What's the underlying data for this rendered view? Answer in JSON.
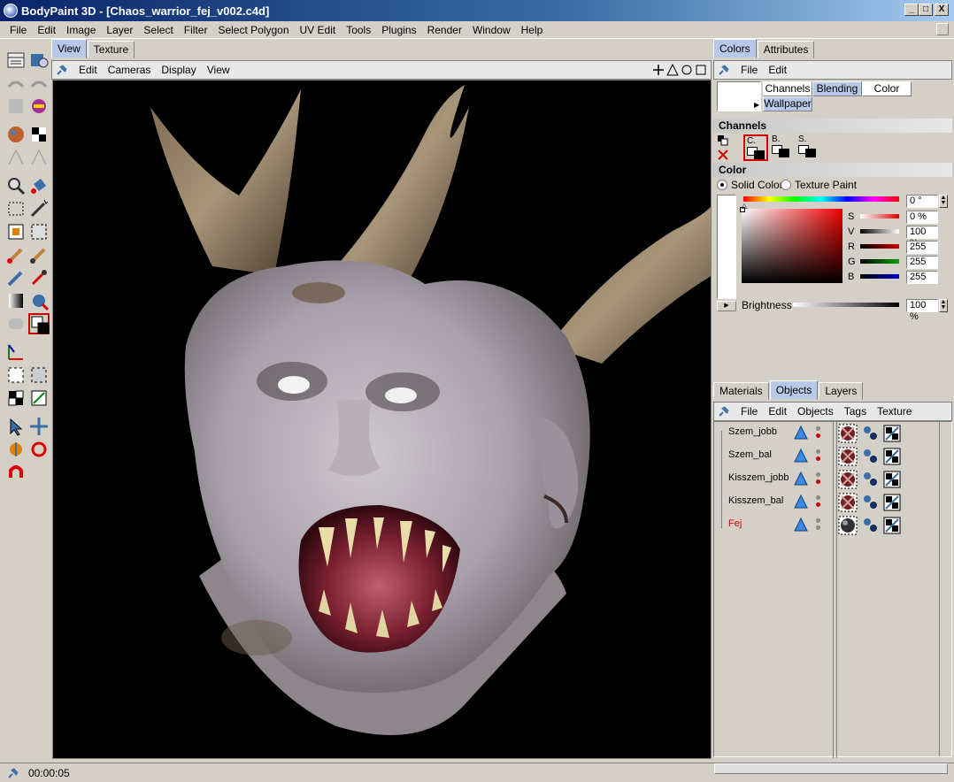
{
  "window": {
    "title": "BodyPaint 3D - [Chaos_warrior_fej_v002.c4d]",
    "min_label": "_",
    "max_label": "□",
    "close_label": "X"
  },
  "menubar": [
    "File",
    "Edit",
    "Image",
    "Layer",
    "Select",
    "Filter",
    "Select Polygon",
    "UV Edit",
    "Tools",
    "Plugins",
    "Render",
    "Window",
    "Help"
  ],
  "view_tabs": [
    "View",
    "Texture"
  ],
  "view_menu": [
    "Edit",
    "Cameras",
    "Display",
    "View"
  ],
  "status": {
    "time": "00:00:05"
  },
  "colors_panel": {
    "tabs": [
      "Colors",
      "Attributes"
    ],
    "menu": [
      "File",
      "Edit"
    ],
    "mode_tabs": [
      "Channels",
      "Blending",
      "Color",
      "Wallpaper"
    ],
    "channels_header": "Channels",
    "channel_labels": [
      "C.",
      "B.",
      "S."
    ],
    "color_header": "Color",
    "radio_solid": "Solid Color",
    "radio_texture": "Texture Paint",
    "hue_value": "0 °",
    "sliders": [
      {
        "label": "S",
        "value": "0 %",
        "color": "#e00000"
      },
      {
        "label": "V",
        "value": "100 %",
        "color": "#000000"
      },
      {
        "label": "R",
        "value": "255",
        "color": "#cc0000"
      },
      {
        "label": "G",
        "value": "255",
        "color": "#00a000"
      },
      {
        "label": "B",
        "value": "255",
        "color": "#0000cc"
      }
    ],
    "brightness_label": "Brightness",
    "brightness_value": "100 %"
  },
  "objects_panel": {
    "tabs": [
      "Materials",
      "Objects",
      "Layers"
    ],
    "menu": [
      "File",
      "Edit",
      "Objects",
      "Tags",
      "Texture"
    ],
    "objects": [
      {
        "name": "Szem_jobb",
        "selected": false
      },
      {
        "name": "Szem_bal",
        "selected": false
      },
      {
        "name": "Kisszem_jobb",
        "selected": false
      },
      {
        "name": "Kisszem_bal",
        "selected": false
      },
      {
        "name": "Fej",
        "selected": true
      }
    ]
  }
}
